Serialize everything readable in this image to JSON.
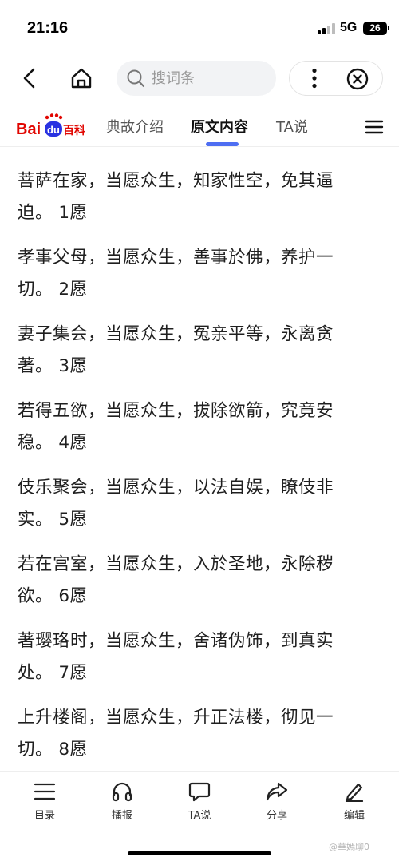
{
  "status_bar": {
    "time": "21:16",
    "network": "5G",
    "battery": "26"
  },
  "nav": {
    "search_placeholder": "搜词条"
  },
  "tabs": {
    "logo": {
      "text_bai": "Bai",
      "text_du": "du",
      "text_baike": "百科"
    },
    "items": [
      {
        "label": "典故介绍",
        "active": false
      },
      {
        "label": "原文内容",
        "active": true
      },
      {
        "label": "TA说",
        "active": false
      }
    ]
  },
  "content": {
    "verses": [
      {
        "line1": "菩萨在家，当愿众生，知家性空，免其逼",
        "line2": "迫。 1愿"
      },
      {
        "line1": "孝事父母，当愿众生，善事於佛，养护一",
        "line2": "切。 2愿"
      },
      {
        "line1": "妻子集会，当愿众生，冤亲平等，永离贪",
        "line2": "著。 3愿"
      },
      {
        "line1": "若得五欲，当愿众生，拔除欲箭，究竟安",
        "line2": "稳。 4愿"
      },
      {
        "line1": "伎乐聚会，当愿众生，以法自娱，瞭伎非",
        "line2": "实。 5愿"
      },
      {
        "line1": "若在宫室，当愿众生，入於圣地，永除秽",
        "line2": "欲。 6愿"
      },
      {
        "line1": "著璎珞时，当愿众生，舍诸伪饰，到真实",
        "line2": "处。 7愿"
      },
      {
        "line1": "上升楼阁，当愿众生，升正法楼，彻见一",
        "line2": "切。 8愿"
      }
    ]
  },
  "bottom_bar": {
    "items": [
      {
        "label": "目录",
        "icon": "list-icon"
      },
      {
        "label": "播报",
        "icon": "headphones-icon"
      },
      {
        "label": "TA说",
        "icon": "comment-icon"
      },
      {
        "label": "分享",
        "icon": "share-icon"
      },
      {
        "label": "编辑",
        "icon": "pencil-icon"
      }
    ],
    "watermark": "@華嫣聊0"
  },
  "colors": {
    "accent": "#4e6ef2",
    "baidu_red": "#e10601",
    "baidu_blue": "#2932e1"
  }
}
